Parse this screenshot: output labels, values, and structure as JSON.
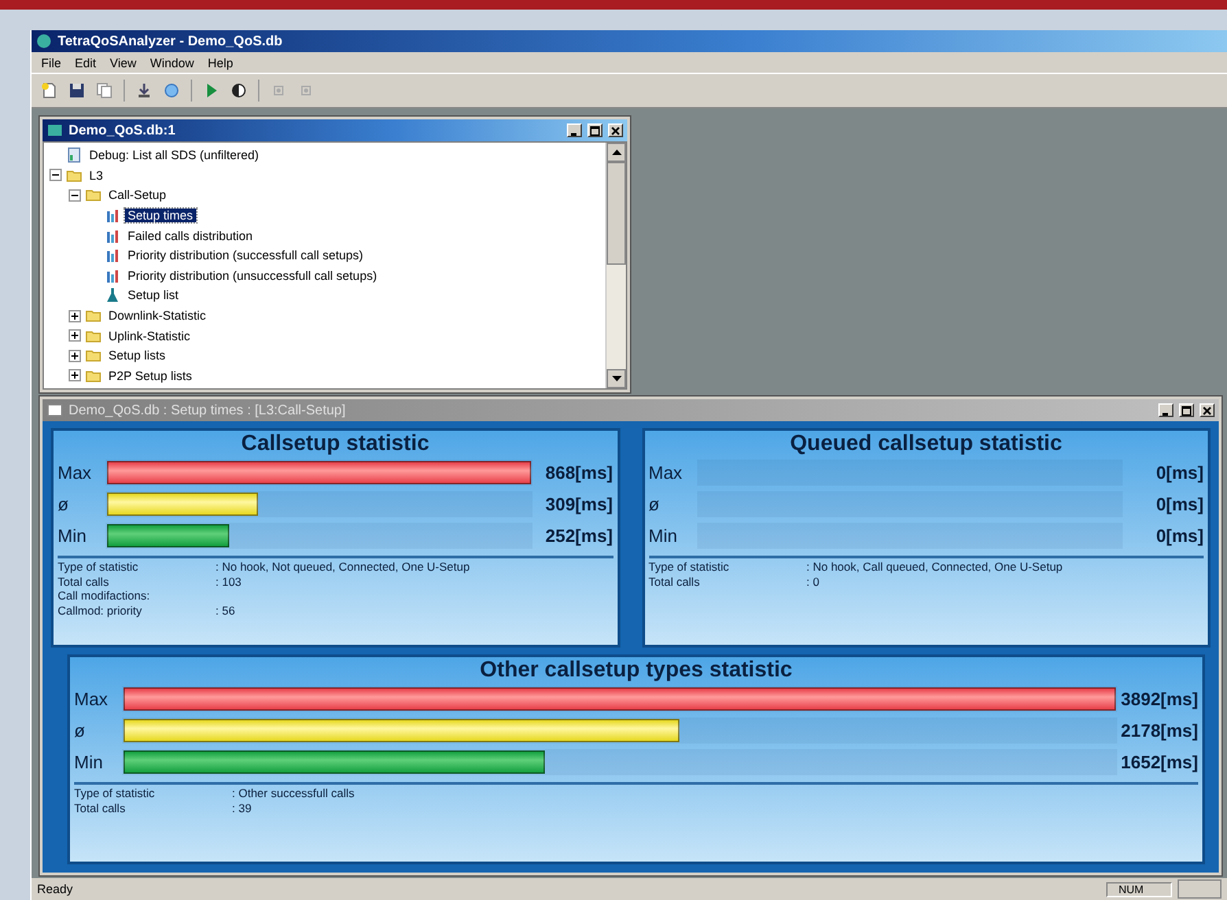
{
  "window": {
    "title": "TetraQoSAnalyzer - Demo_QoS.db"
  },
  "menu": [
    "File",
    "Edit",
    "View",
    "Window",
    "Help"
  ],
  "toolbar": [
    {
      "kind": "new"
    },
    {
      "kind": "save"
    },
    {
      "kind": "copy"
    },
    {
      "kind": "down"
    },
    {
      "kind": "find"
    },
    {
      "kind": "play"
    },
    {
      "kind": "contrast"
    },
    {
      "kind": "dim"
    },
    {
      "kind": "dim"
    }
  ],
  "tree_window": {
    "title": "Demo_QoS.db:1",
    "items": [
      {
        "label": "Debug: List all SDS (unfiltered)",
        "kind": "report",
        "selected": false
      },
      {
        "label": "L3",
        "kind": "folder",
        "expanded": true,
        "selected": false,
        "children": [
          {
            "label": "Call-Setup",
            "kind": "folder",
            "expanded": true,
            "selected": false,
            "children": [
              {
                "label": "Setup times",
                "kind": "chart",
                "selected": true
              },
              {
                "label": "Failed calls distribution",
                "kind": "chart",
                "selected": false
              },
              {
                "label": "Priority distribution (successfull call setups)",
                "kind": "chart",
                "selected": false
              },
              {
                "label": "Priority distribution (unsuccessfull call setups)",
                "kind": "chart",
                "selected": false
              },
              {
                "label": "Setup list",
                "kind": "list",
                "selected": false
              }
            ]
          },
          {
            "label": "Downlink-Statistic",
            "kind": "folder",
            "expanded": false,
            "selected": false
          },
          {
            "label": "Uplink-Statistic",
            "kind": "folder",
            "expanded": false,
            "selected": false
          },
          {
            "label": "Setup lists",
            "kind": "folder",
            "expanded": false,
            "selected": false
          },
          {
            "label": "P2P Setup lists",
            "kind": "folder",
            "expanded": false,
            "selected": false
          }
        ]
      }
    ]
  },
  "stats_window": {
    "title": "Demo_QoS.db : Setup times : [L3:Call-Setup]",
    "panels": [
      {
        "title": "Callsetup statistic",
        "rows": [
          {
            "kind": "max",
            "label": "Max",
            "level": 1.0,
            "reading": "868[ms]"
          },
          {
            "kind": "avg",
            "label": "ø",
            "level": 0.356,
            "reading": "309[ms]"
          },
          {
            "kind": "min",
            "label": "Min",
            "level": 0.29,
            "reading": "252[ms]"
          }
        ],
        "info": [
          {
            "label": "Type of statistic",
            "value": ": No hook, Not queued, Connected, One U-Setup"
          },
          {
            "label": "Total calls",
            "value": ": 103"
          },
          {
            "label": "Call modifactions:"
          },
          {
            "label": "Callmod: priority",
            "value": ": 56"
          }
        ]
      },
      {
        "title": "Queued callsetup statistic",
        "rows": [
          {
            "kind": "max",
            "label": "Max",
            "reading": "0[ms]"
          },
          {
            "kind": "avg",
            "label": "ø",
            "reading": "0[ms]"
          },
          {
            "kind": "min",
            "label": "Min",
            "reading": "0[ms]"
          }
        ],
        "info": [
          {
            "label": "Type of statistic",
            "value": ": No hook, Call queued, Connected, One U-Setup"
          },
          {
            "label": "Total calls",
            "value": ": 0"
          }
        ]
      },
      {
        "title": "Other callsetup types statistic",
        "rows": [
          {
            "kind": "max",
            "label": "Max",
            "level": 1.0,
            "reading": "3892[ms]"
          },
          {
            "kind": "avg",
            "label": "ø",
            "level": 0.56,
            "reading": "2178[ms]"
          },
          {
            "kind": "min",
            "label": "Min",
            "level": 0.424,
            "reading": "1652[ms]"
          }
        ],
        "info": [
          {
            "label": "Type of statistic",
            "value": ": Other successfull calls"
          },
          {
            "label": "Total calls",
            "value": ": 39"
          }
        ]
      }
    ]
  },
  "status_bar": {
    "text": "Ready",
    "indicator": "NUM"
  }
}
